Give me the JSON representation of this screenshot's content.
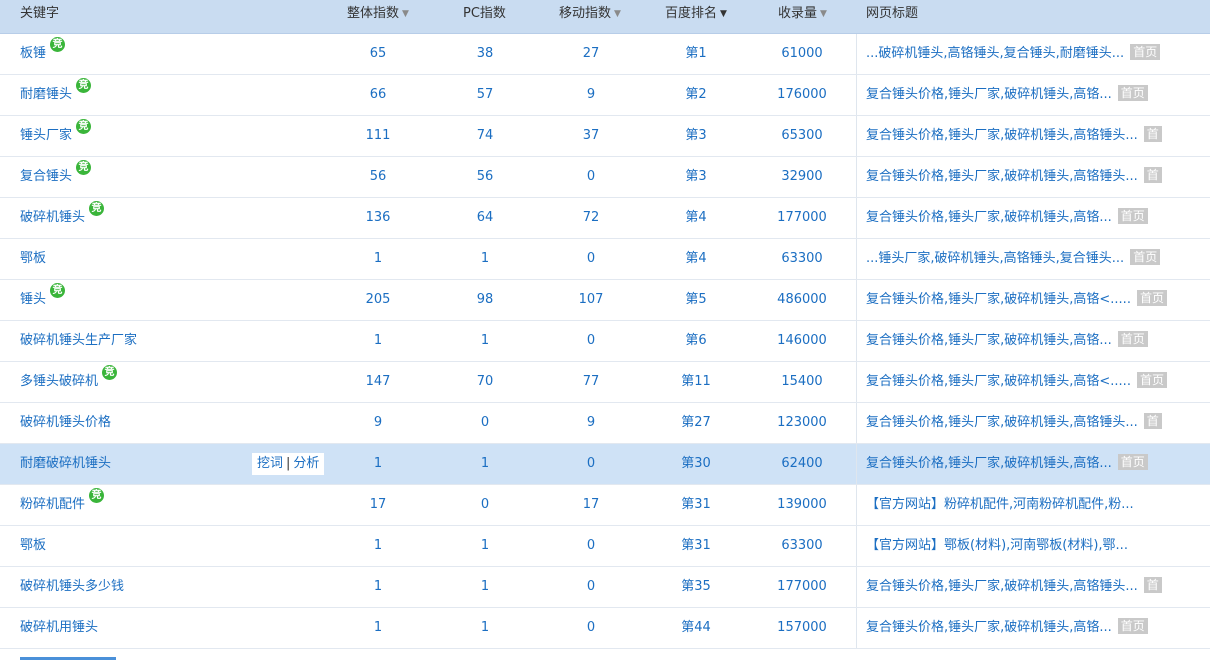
{
  "headers": {
    "keyword": "关键字",
    "total_index": "整体指数",
    "pc_index": "PC指数",
    "mobile_index": "移动指数",
    "baidu_rank": "百度排名",
    "indexed": "收录量",
    "page_title": "网页标题"
  },
  "colors": {
    "header_bg": "#c9dcf1",
    "link": "#1b6ec2",
    "selected_row": "#cfe2f6",
    "badge": "#3ab53a"
  },
  "badge_label": "竞",
  "row_actions": {
    "dig": "挖词",
    "sep": "|",
    "analyze": "分析"
  },
  "rows": [
    {
      "keyword": "板锤",
      "bid": true,
      "total": "65",
      "pc": "38",
      "mobile": "27",
      "rank": "第1",
      "indexed": "61000",
      "title": "...破碎机锤头,高铬锤头,复合锤头,耐磨锤头...",
      "tag": "首页"
    },
    {
      "keyword": "耐磨锤头",
      "bid": true,
      "total": "66",
      "pc": "57",
      "mobile": "9",
      "rank": "第2",
      "indexed": "176000",
      "title": "复合锤头价格,锤头厂家,破碎机锤头,高铬...",
      "tag": "首页"
    },
    {
      "keyword": "锤头厂家",
      "bid": true,
      "total": "111",
      "pc": "74",
      "mobile": "37",
      "rank": "第3",
      "indexed": "65300",
      "title": "复合锤头价格,锤头厂家,破碎机锤头,高铬锤头...",
      "tag": "首"
    },
    {
      "keyword": "复合锤头",
      "bid": true,
      "total": "56",
      "pc": "56",
      "mobile": "0",
      "rank": "第3",
      "indexed": "32900",
      "title": "复合锤头价格,锤头厂家,破碎机锤头,高铬锤头...",
      "tag": "首"
    },
    {
      "keyword": "破碎机锤头",
      "bid": true,
      "total": "136",
      "pc": "64",
      "mobile": "72",
      "rank": "第4",
      "indexed": "177000",
      "title": "复合锤头价格,锤头厂家,破碎机锤头,高铬...",
      "tag": "首页"
    },
    {
      "keyword": "鄂板",
      "bid": false,
      "total": "1",
      "pc": "1",
      "mobile": "0",
      "rank": "第4",
      "indexed": "63300",
      "title": "...锤头厂家,破碎机锤头,高铬锤头,复合锤头...",
      "tag": "首页"
    },
    {
      "keyword": "锤头",
      "bid": true,
      "total": "205",
      "pc": "98",
      "mobile": "107",
      "rank": "第5",
      "indexed": "486000",
      "title": "复合锤头价格,锤头厂家,破碎机锤头,高铬<.....",
      "tag": "首页"
    },
    {
      "keyword": "破碎机锤头生产厂家",
      "bid": false,
      "total": "1",
      "pc": "1",
      "mobile": "0",
      "rank": "第6",
      "indexed": "146000",
      "title": "复合锤头价格,锤头厂家,破碎机锤头,高铬...",
      "tag": "首页"
    },
    {
      "keyword": "多锤头破碎机",
      "bid": true,
      "total": "147",
      "pc": "70",
      "mobile": "77",
      "rank": "第11",
      "indexed": "15400",
      "title": "复合锤头价格,锤头厂家,破碎机锤头,高铬<.....",
      "tag": "首页"
    },
    {
      "keyword": "破碎机锤头价格",
      "bid": false,
      "total": "9",
      "pc": "0",
      "mobile": "9",
      "rank": "第27",
      "indexed": "123000",
      "title": "复合锤头价格,锤头厂家,破碎机锤头,高铬锤头...",
      "tag": "首"
    },
    {
      "keyword": "耐磨破碎机锤头",
      "bid": false,
      "selected": true,
      "total": "1",
      "pc": "1",
      "mobile": "0",
      "rank": "第30",
      "indexed": "62400",
      "title": "复合锤头价格,锤头厂家,破碎机锤头,高铬...",
      "tag": "首页"
    },
    {
      "keyword": "粉碎机配件",
      "bid": true,
      "total": "17",
      "pc": "0",
      "mobile": "17",
      "rank": "第31",
      "indexed": "139000",
      "title": "【官方网站】粉碎机配件,河南粉碎机配件,粉...",
      "tag": ""
    },
    {
      "keyword": "鄂板",
      "bid": false,
      "total": "1",
      "pc": "1",
      "mobile": "0",
      "rank": "第31",
      "indexed": "63300",
      "title": "【官方网站】鄂板(材料),河南鄂板(材料),鄂...",
      "tag": ""
    },
    {
      "keyword": "破碎机锤头多少钱",
      "bid": false,
      "total": "1",
      "pc": "1",
      "mobile": "0",
      "rank": "第35",
      "indexed": "177000",
      "title": "复合锤头价格,锤头厂家,破碎机锤头,高铬锤头...",
      "tag": "首"
    },
    {
      "keyword": "破碎机用锤头",
      "bid": false,
      "total": "1",
      "pc": "1",
      "mobile": "0",
      "rank": "第44",
      "indexed": "157000",
      "title": "复合锤头价格,锤头厂家,破碎机锤头,高铬...",
      "tag": "首页"
    }
  ]
}
